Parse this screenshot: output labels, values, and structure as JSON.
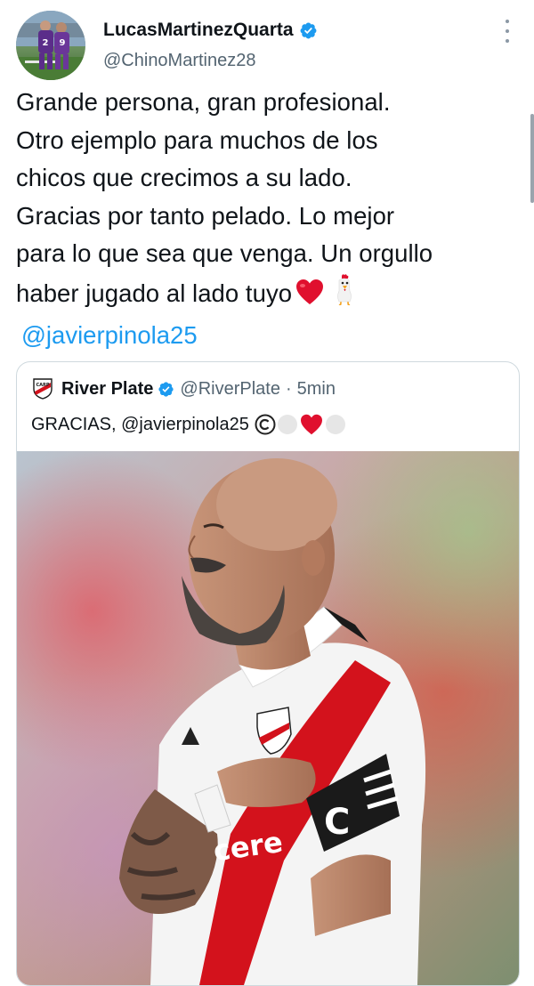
{
  "author": {
    "name": "LucasMartinezQuarta",
    "handle": "@ChinoMartinez28",
    "avatar_numbers": "2 9"
  },
  "tweet": {
    "lines": [
      "Grande persona, gran profesional.",
      "Otro ejemplo para muchos de los",
      "chicos que crecimos a su lado.",
      "Gracias por tanto pelado. Lo mejor",
      "para lo que sea que venga. Un orgullo",
      "haber jugado al lado tuyo"
    ],
    "emojis": [
      "red-heart",
      "rooster"
    ],
    "mention": "@javierpinola25"
  },
  "quoted_tweet": {
    "name": "River Plate",
    "handle": "@RiverPlate",
    "separator": "·",
    "time": "5min",
    "text": "GRACIAS, @javierpinola25",
    "emojis": [
      "copyright",
      "white-circle",
      "red-heart",
      "white-circle"
    ],
    "photo_jersey_text": "cere",
    "photo_armband_text": "C"
  },
  "colors": {
    "accent": "#1d9bf0",
    "verified": "#1d9bf0",
    "secondary_text": "#536471",
    "heart": "#e0102e",
    "river_red": "#d3121c"
  },
  "icons": [
    "verified-badge-icon",
    "more-options-icon",
    "river-plate-crest-icon"
  ]
}
